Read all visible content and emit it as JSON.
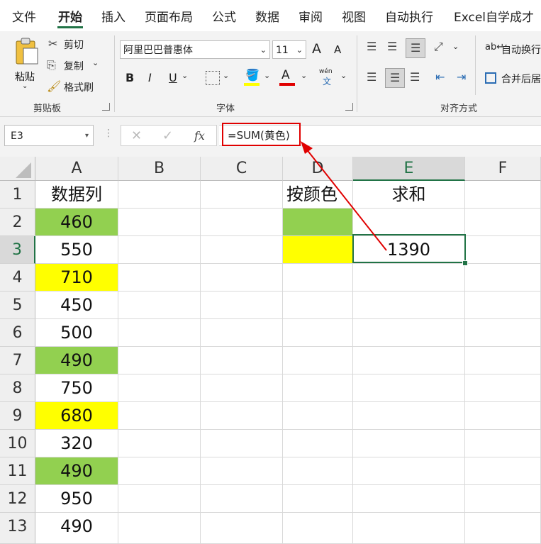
{
  "tabs": [
    "文件",
    "开始",
    "插入",
    "页面布局",
    "公式",
    "数据",
    "审阅",
    "视图",
    "自动执行",
    "Excel自学成才"
  ],
  "ribbon": {
    "clipboard": {
      "paste": "粘贴",
      "cut": "剪切",
      "copy": "复制",
      "format_painter": "格式刷",
      "label": "剪贴板"
    },
    "font": {
      "name": "阿里巴巴普惠体",
      "size": "11",
      "bold": "B",
      "italic": "I",
      "underline": "U",
      "font_color_glyph": "A",
      "phonetic": "wén",
      "phonetic_char": "文",
      "grow": "A",
      "shrink": "A",
      "label": "字体",
      "fill_color": "#ffff00",
      "text_color": "#e00000"
    },
    "alignment": {
      "wrap": "自动换行",
      "merge": "合并后居",
      "label": "对齐方式"
    }
  },
  "formula_bar": {
    "name_box": "E3",
    "fx": "fx",
    "formula": "=SUM(黄色)",
    "highlight_color": "#e00000"
  },
  "columns": [
    "A",
    "B",
    "C",
    "D",
    "E",
    "F"
  ],
  "rows": [
    "1",
    "2",
    "3",
    "4",
    "5",
    "6",
    "7",
    "8",
    "9",
    "10",
    "11",
    "12",
    "13"
  ],
  "cells": {
    "A": [
      "数据列",
      "460",
      "550",
      "710",
      "450",
      "500",
      "490",
      "750",
      "680",
      "320",
      "490",
      "950",
      "490"
    ],
    "D1": "按颜色",
    "E1": "求和",
    "E3": "1390"
  },
  "colors": {
    "green": "#92d050",
    "yellow": "#ffff00",
    "accent": "#217346"
  }
}
